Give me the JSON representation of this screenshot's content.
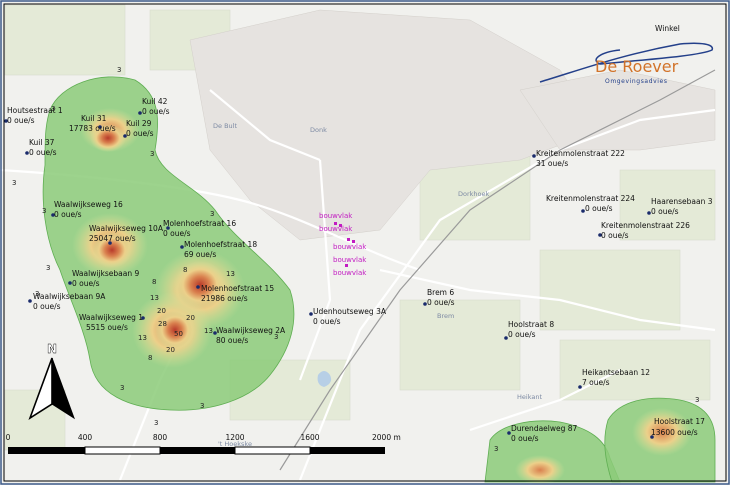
{
  "logo": {
    "name": "De Roever",
    "subtitle": "Omgevingsadvies"
  },
  "place_names": {
    "winkel": "Winkel",
    "dorkhoek": "Dorkhoek",
    "brem": "Brem",
    "heikant": "Heikant",
    "t_hoekske": "'t Hoekske",
    "de_bult": "De Bult",
    "donk": "Donk"
  },
  "bouwvlak_labels": [
    "bouwvlak",
    "bouwvlak",
    "bouwvlak",
    "bouwvlak",
    "bouwvlak"
  ],
  "sources": [
    {
      "name": "Houtsestraat 1",
      "value": "0 oue/s"
    },
    {
      "name": "Kuil 31",
      "value": "17783 oue/s"
    },
    {
      "name": "Kuil 42",
      "value": "0 oue/s"
    },
    {
      "name": "Kuil 29",
      "value": "0 oue/s"
    },
    {
      "name": "Kuil 37",
      "value": "0 oue/s"
    },
    {
      "name": "Waalwijkseweg 16",
      "value": "0 oue/s"
    },
    {
      "name": "Waalwijkseweg 10A",
      "value": "25047 oue/s"
    },
    {
      "name": "Molenhoefstraat 16",
      "value": "0 oue/s"
    },
    {
      "name": "Molenhoefstraat 18",
      "value": "69 oue/s"
    },
    {
      "name": "Waalwijksebaan 9",
      "value": "0 oue/s"
    },
    {
      "name": "Molenhoefstraat 15",
      "value": "21986 oue/s"
    },
    {
      "name": "Waalwijksebaan 9A",
      "value": "0 oue/s"
    },
    {
      "name": "Waalwijkseweg 1",
      "value": "5515 oue/s"
    },
    {
      "name": "Waalwijkseweg 2A",
      "value": "80 oue/s"
    },
    {
      "name": "Udenhoutseweg 3A",
      "value": "0 oue/s"
    },
    {
      "name": "Brem 6",
      "value": "0 oue/s"
    },
    {
      "name": "Hoolstraat 8",
      "value": "0 oue/s"
    },
    {
      "name": "Kreitenmolenstraat 222",
      "value": "31 oue/s"
    },
    {
      "name": "Kreitenmolenstraat 224",
      "value": "0 oue/s"
    },
    {
      "name": "Haarensebaan 3",
      "value": "0 oue/s"
    },
    {
      "name": "Kreitenmolenstraat 226",
      "value": "0 oue/s"
    },
    {
      "name": "Heikantsebaan 12",
      "value": "7 oue/s"
    },
    {
      "name": "Durendaelweg 87",
      "value": "0 oue/s"
    },
    {
      "name": "Hoolstraat 17",
      "value": "13600 oue/s"
    }
  ],
  "contour_labels": [
    "3",
    "3",
    "3",
    "3",
    "3",
    "3",
    "3",
    "3",
    "3",
    "3",
    "3",
    "3",
    "3",
    "3",
    "8",
    "8",
    "8",
    "13",
    "13",
    "13",
    "13",
    "20",
    "20",
    "20",
    "28",
    "50"
  ],
  "north_arrow": "N",
  "scale_bar": {
    "labels": [
      "0",
      "400",
      "800",
      "1200",
      "1600",
      "2000 m"
    ]
  },
  "colors": {
    "map_bg": "#f1f1ee",
    "field": "#e6ebdc",
    "contour_outer": "#7cc46c",
    "contour_mid": "#c8dc8a",
    "contour_inner": "#e8c46e",
    "contour_core": "#c45838",
    "bouwvlak": "#c21cc2",
    "source_marker": "#1a2b6b",
    "logo_accent": "#d2732a",
    "logo_line": "#24408a"
  }
}
